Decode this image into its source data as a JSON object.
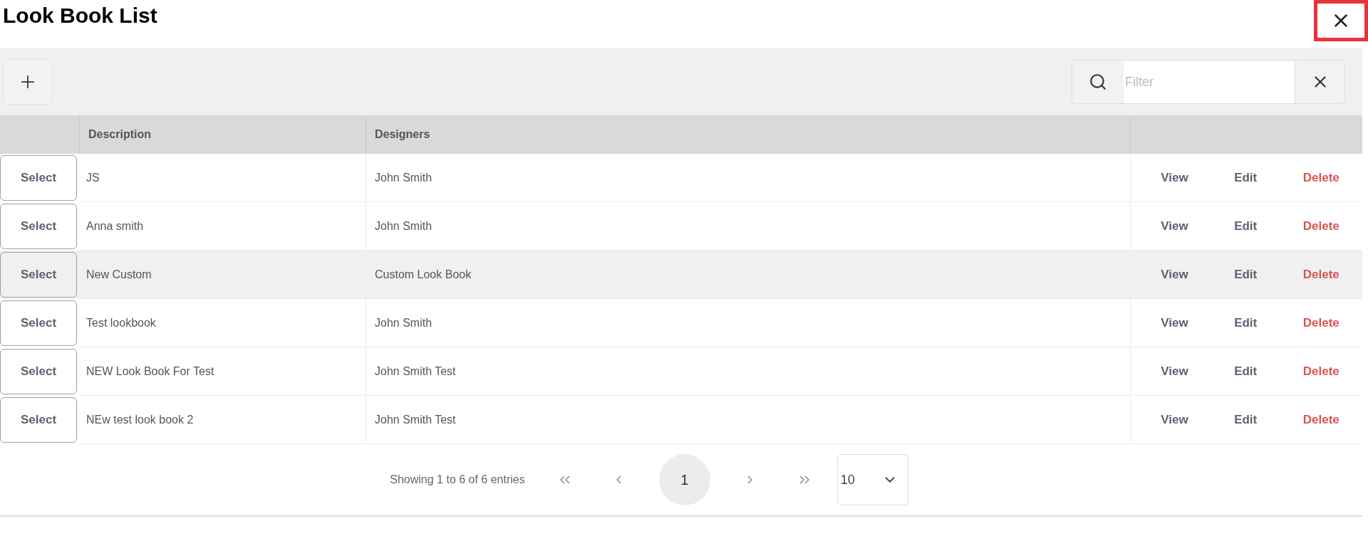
{
  "title": "Look Book List",
  "toolbar": {
    "filter": {
      "placeholder": "Filter"
    }
  },
  "table": {
    "columns": [
      "Description",
      "Designers"
    ],
    "rows": [
      {
        "select": "Select",
        "description": "JS",
        "designers": "John Smith",
        "actions": [
          "View",
          "Edit",
          "Delete"
        ],
        "selected": false
      },
      {
        "select": "Select",
        "description": "Anna smith",
        "designers": "John Smith",
        "actions": [
          "View",
          "Edit",
          "Delete"
        ],
        "selected": false
      },
      {
        "select": "Select",
        "description": "New Custom",
        "designers": "Custom Look Book",
        "actions": [
          "View",
          "Edit",
          "Delete"
        ],
        "selected": true
      },
      {
        "select": "Select",
        "description": "Test lookbook",
        "designers": "John Smith",
        "actions": [
          "View",
          "Edit",
          "Delete"
        ],
        "selected": false
      },
      {
        "select": "Select",
        "description": "NEW Look Book For Test",
        "designers": "John Smith Test",
        "actions": [
          "View",
          "Edit",
          "Delete"
        ],
        "selected": false
      },
      {
        "select": "Select",
        "description": "NEw test look book 2",
        "designers": "John Smith Test",
        "actions": [
          "View",
          "Edit",
          "Delete"
        ],
        "selected": false
      }
    ]
  },
  "pagination": {
    "summary": "Showing 1 to 6 of 6 entries",
    "pages": [
      {
        "label": "1",
        "selected": true
      }
    ],
    "page_size": "10"
  }
}
